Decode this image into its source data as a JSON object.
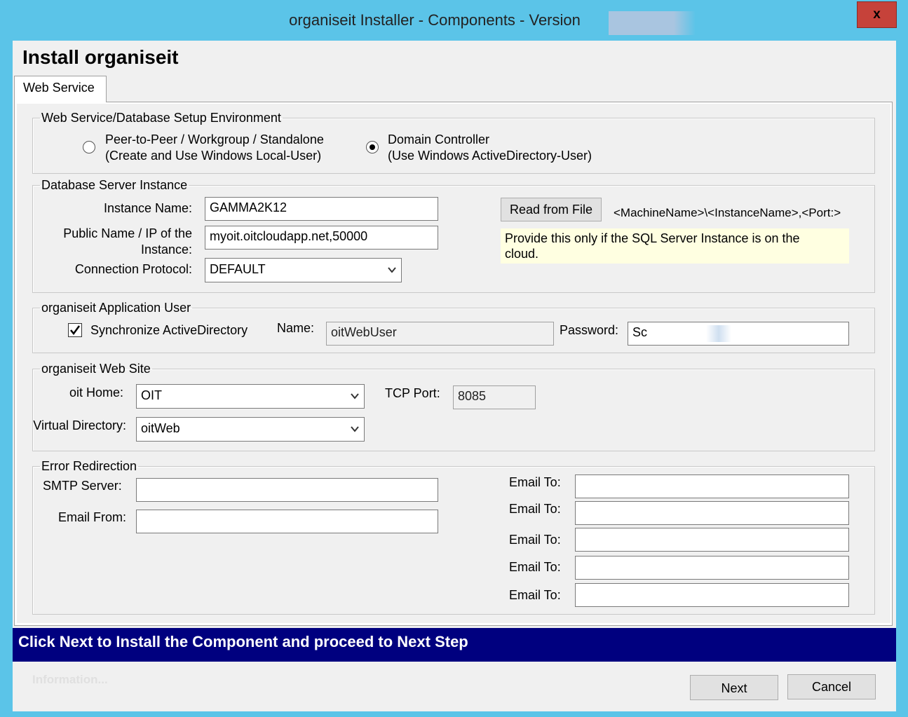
{
  "window": {
    "title": "organiseit Installer - Components - Version",
    "close_glyph": "x"
  },
  "header": {
    "title": "Install organiseit"
  },
  "tabs": [
    {
      "label": "Web Service"
    }
  ],
  "environment": {
    "legend": "Web Service/Database Setup Environment",
    "option1_line1": "Peer-to-Peer / Workgroup / Standalone",
    "option1_line2": "(Create and Use Windows Local-User)",
    "option2_line1": "Domain Controller",
    "option2_line2": "(Use Windows ActiveDirectory-User)",
    "selected": "Domain Controller"
  },
  "db_instance": {
    "legend": "Database Server Instance",
    "instance_label": "Instance Name:",
    "instance_value": "GAMMA2K12",
    "public_label_line1": "Public Name / IP of the",
    "public_label_line2": "Instance:",
    "public_value": "myoit.oitcloudapp.net,50000",
    "protocol_label": "Connection Protocol:",
    "protocol_value": "DEFAULT",
    "read_button": "Read from File",
    "format_hint": "<MachineName>\\<InstanceName>,<Port:>",
    "cloud_hint_line1": "Provide this only if the SQL Server Instance is on the",
    "cloud_hint_line2": "cloud."
  },
  "app_user": {
    "legend": "organiseit Application User",
    "sync_label": "Synchronize ActiveDirectory",
    "sync_checked": true,
    "name_label": "Name:",
    "name_value": "oitWebUser",
    "password_label": "Password:",
    "password_value": "Sc"
  },
  "web_site": {
    "legend": "organiseit Web Site",
    "home_label": "oit Home:",
    "home_value": "OIT",
    "port_label": "TCP Port:",
    "port_value": "8085",
    "vdir_label": "Virtual Directory:",
    "vdir_value": "oitWeb"
  },
  "error_redirect": {
    "legend": "Error Redirection",
    "smtp_label": "SMTP Server:",
    "smtp_value": "",
    "from_label": "Email From:",
    "from_value": "",
    "email_to_label": "Email To:",
    "email_to_values": [
      "",
      "",
      "",
      "",
      ""
    ]
  },
  "footer": {
    "banner": "Click Next to Install the Component and proceed to Next Step",
    "info": "Information...",
    "next": "Next",
    "cancel": "Cancel"
  },
  "colors": {
    "titlebar": "#5bc4e8",
    "banner": "#00007f",
    "close": "#c6423a"
  }
}
